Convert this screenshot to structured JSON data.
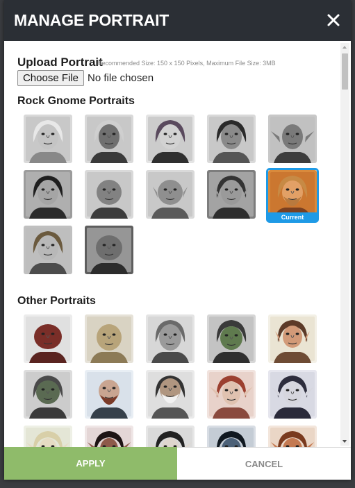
{
  "modal": {
    "title": "MANAGE PORTRAIT"
  },
  "upload": {
    "label": "Upload Portrait",
    "hint": "Recommended Size: 150 x 150 Pixels, Maximum File Size: 3MB",
    "choose_file_label": "Choose File",
    "no_file_text": "No file chosen"
  },
  "rock_gnome": {
    "title": "Rock Gnome Portraits",
    "current_label": "Current",
    "current_index": 9,
    "count": 12
  },
  "other": {
    "title": "Other Portraits"
  },
  "footer": {
    "apply_label": "APPLY",
    "cancel_label": "CANCEL"
  },
  "colors": {
    "header_bg": "#2b2f35",
    "apply_bg": "#8fbb6a",
    "current_accent": "#1e9ae6"
  },
  "icons": {
    "close": "close-icon",
    "portrait": "portrait-image"
  }
}
